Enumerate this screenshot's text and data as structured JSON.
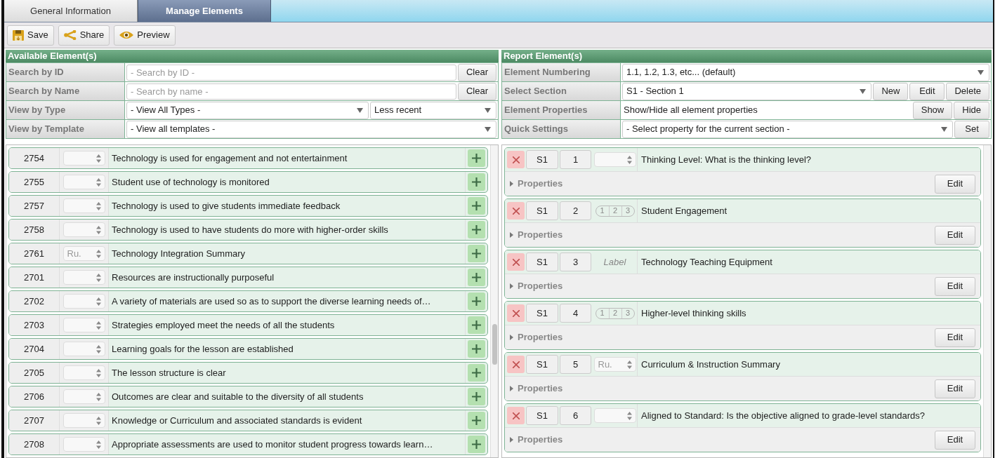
{
  "tabs": [
    {
      "label": "General Information",
      "selected": false
    },
    {
      "label": "Manage Elements",
      "selected": true
    }
  ],
  "toolbar": [
    {
      "kind": "save",
      "label": "Save"
    },
    {
      "kind": "share",
      "label": "Share"
    },
    {
      "kind": "preview",
      "label": "Preview"
    }
  ],
  "available": {
    "title": "Available Element(s)",
    "filters": [
      {
        "label": "Search by ID",
        "controls": [
          {
            "kind": "input",
            "placeholder": "- Search by ID -"
          },
          {
            "kind": "button",
            "label": "Clear"
          }
        ]
      },
      {
        "label": "Search by Name",
        "controls": [
          {
            "kind": "input",
            "placeholder": "- Search by name -"
          },
          {
            "kind": "button",
            "label": "Clear"
          }
        ]
      },
      {
        "label": "View by Type",
        "controls": [
          {
            "kind": "select",
            "value": "- View All Types -"
          },
          {
            "kind": "select",
            "value": "Less recent"
          }
        ]
      },
      {
        "label": "View by Template",
        "controls": [
          {
            "kind": "select",
            "value": "- View all templates -"
          }
        ]
      }
    ],
    "rows": [
      {
        "id": "2754",
        "text": "Technology is used for engagement and not entertainment"
      },
      {
        "id": "2755",
        "text": "Student use of technology is monitored"
      },
      {
        "id": "2757",
        "text": "Technology is used to give students immediate feedback"
      },
      {
        "id": "2758",
        "text": "Technology is used to have students do more with higher-order skills"
      },
      {
        "id": "2761",
        "choice": "Ru.",
        "text": "Technology Integration Summary"
      },
      {
        "id": "2701",
        "text": "Resources are instructionally purposeful"
      },
      {
        "id": "2702",
        "text": "A variety of materials are used so as to support the diverse learning needs of…"
      },
      {
        "id": "2703",
        "text": "Strategies employed meet the needs of all the students"
      },
      {
        "id": "2704",
        "text": "Learning goals for the lesson are established"
      },
      {
        "id": "2705",
        "text": "The lesson structure is clear"
      },
      {
        "id": "2706",
        "text": "Outcomes are clear and suitable to the diversity of all students"
      },
      {
        "id": "2707",
        "text": "Knowledge or Curriculum and associated standards is evident"
      },
      {
        "id": "2708",
        "text": "Appropriate assessments are used to monitor student progress towards learn…"
      }
    ]
  },
  "report": {
    "title": "Report Element(s)",
    "filters": [
      {
        "label": "Element Numbering",
        "controls": [
          {
            "kind": "select",
            "value": "1.1, 1.2, 1.3, etc... (default)"
          }
        ]
      },
      {
        "label": "Select Section",
        "controls": [
          {
            "kind": "select",
            "value": "S1 - Section 1"
          },
          {
            "kind": "button",
            "label": "New"
          },
          {
            "kind": "button",
            "label": "Edit"
          },
          {
            "kind": "button",
            "label": "Delete"
          }
        ]
      },
      {
        "label": "Element Properties",
        "controls": [
          {
            "kind": "text",
            "value": "Show/Hide all element properties"
          },
          {
            "kind": "button",
            "label": "Show"
          },
          {
            "kind": "button",
            "label": "Hide"
          }
        ]
      },
      {
        "label": "Quick Settings",
        "controls": [
          {
            "kind": "select",
            "value": "- Select property for the current section -"
          },
          {
            "kind": "button",
            "label": "Set"
          }
        ]
      }
    ],
    "items": [
      {
        "section": "S1",
        "number": "1",
        "control": {
          "kind": "select"
        },
        "text": "Thinking Level: What is the thinking level?",
        "properties": "Properties",
        "edit": "Edit"
      },
      {
        "section": "S1",
        "number": "2",
        "control": {
          "kind": "scale",
          "labels": [
            "1",
            "2",
            "3"
          ]
        },
        "text": "Student Engagement",
        "properties": "Properties",
        "edit": "Edit"
      },
      {
        "section": "S1",
        "number": "3",
        "control": {
          "kind": "label",
          "value": "Label"
        },
        "text": "Technology Teaching Equipment",
        "properties": "Properties",
        "edit": "Edit"
      },
      {
        "section": "S1",
        "number": "4",
        "control": {
          "kind": "scale",
          "labels": [
            "1",
            "2",
            "3"
          ]
        },
        "text": "Higher-level thinking skills",
        "properties": "Properties",
        "edit": "Edit"
      },
      {
        "section": "S1",
        "number": "5",
        "control": {
          "kind": "select",
          "value": "Ru."
        },
        "text": "Curriculum & Instruction Summary",
        "properties": "Properties",
        "edit": "Edit"
      },
      {
        "section": "S1",
        "number": "6",
        "control": {
          "kind": "select"
        },
        "text": "Aligned to Standard: Is the objective aligned to grade-level standards?",
        "properties": "Properties",
        "edit": "Edit"
      }
    ]
  }
}
